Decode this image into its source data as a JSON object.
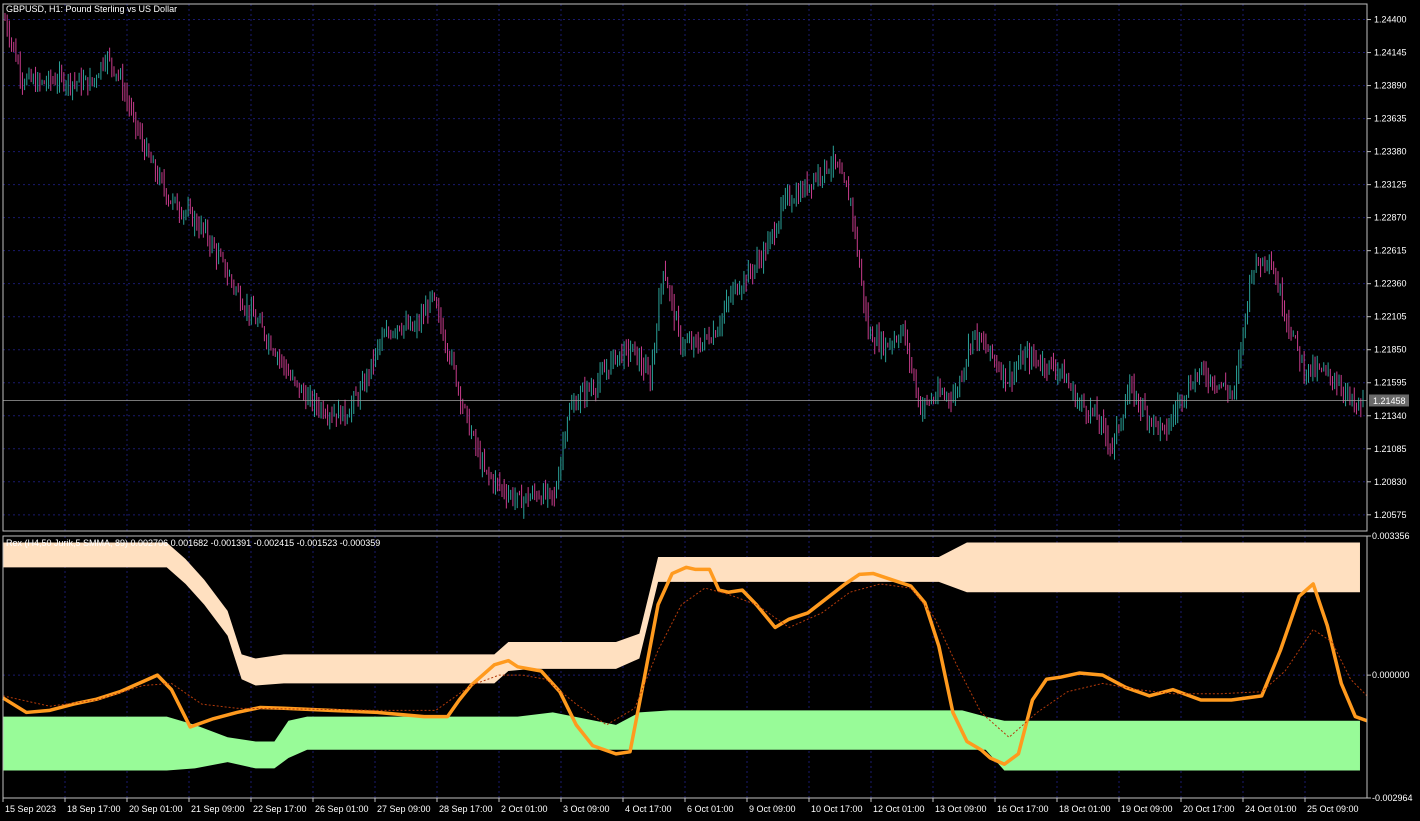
{
  "main_title": "GBPUSD, H1:  Pound Sterling vs US Dollar",
  "indicator_title": "Rex (H4,50 Jurik,5 SMMA, 89) 0.002706 0.001682 -0.001391 -0.002415 -0.001523 -0.000359",
  "current_price_label": "1.21458",
  "colors": {
    "background": "#000000",
    "frame": "#c0c0c0",
    "grid": "#1a1a6e",
    "bull_candle": "#2aa198",
    "bear_candle": "#c83c8c",
    "upper_band": "#ffe0c0",
    "lower_band": "#98fb98",
    "rex_line": "#ff9a1e",
    "signal_line": "#b43a0a",
    "price_line": "#a0a0a0"
  },
  "chart_data": [
    {
      "type": "candlestick",
      "symbol": "GBPUSD",
      "timeframe": "H1",
      "ylim": [
        1.2045,
        1.2452
      ],
      "y_ticks": [
        "1.24400",
        "1.24145",
        "1.23890",
        "1.23635",
        "1.23380",
        "1.23125",
        "1.22870",
        "1.22615",
        "1.22360",
        "1.22105",
        "1.21850",
        "1.21595",
        "1.21340",
        "1.21085",
        "1.20830",
        "1.20575"
      ],
      "current_price": 1.21458,
      "close_path": [
        [
          0,
          1.244
        ],
        [
          8,
          1.2395
        ],
        [
          16,
          1.239
        ],
        [
          24,
          1.2394
        ],
        [
          32,
          1.2392
        ],
        [
          40,
          1.2391
        ],
        [
          46,
          1.2412
        ],
        [
          52,
          1.2398
        ],
        [
          60,
          1.2357
        ],
        [
          68,
          1.2325
        ],
        [
          76,
          1.23
        ],
        [
          84,
          1.229
        ],
        [
          92,
          1.2275
        ],
        [
          100,
          1.225
        ],
        [
          108,
          1.2225
        ],
        [
          116,
          1.2205
        ],
        [
          124,
          1.2185
        ],
        [
          132,
          1.216
        ],
        [
          140,
          1.2145
        ],
        [
          148,
          1.2138
        ],
        [
          156,
          1.2135
        ],
        [
          164,
          1.2155
        ],
        [
          172,
          1.219
        ],
        [
          180,
          1.2205
        ],
        [
          188,
          1.22
        ],
        [
          196,
          1.2225
        ],
        [
          204,
          1.2182
        ],
        [
          212,
          1.213
        ],
        [
          220,
          1.209
        ],
        [
          228,
          1.2078
        ],
        [
          236,
          1.2068
        ],
        [
          244,
          1.2074
        ],
        [
          252,
          1.207
        ],
        [
          258,
          1.2135
        ],
        [
          264,
          1.215
        ],
        [
          272,
          1.216
        ],
        [
          280,
          1.218
        ],
        [
          288,
          1.2185
        ],
        [
          296,
          1.2162
        ],
        [
          302,
          1.225
        ],
        [
          310,
          1.219
        ],
        [
          318,
          1.2188
        ],
        [
          326,
          1.22
        ],
        [
          334,
          1.223
        ],
        [
          342,
          1.2245
        ],
        [
          350,
          1.2265
        ],
        [
          358,
          1.23
        ],
        [
          366,
          1.2308
        ],
        [
          372,
          1.232
        ],
        [
          380,
          1.233
        ],
        [
          388,
          1.23
        ],
        [
          396,
          1.2198
        ],
        [
          404,
          1.2188
        ],
        [
          412,
          1.22
        ],
        [
          420,
          1.214
        ],
        [
          428,
          1.215
        ],
        [
          436,
          1.215
        ],
        [
          444,
          1.2198
        ],
        [
          452,
          1.2182
        ],
        [
          460,
          1.2162
        ],
        [
          468,
          1.218
        ],
        [
          476,
          1.2175
        ],
        [
          484,
          1.217
        ],
        [
          492,
          1.2145
        ],
        [
          500,
          1.2135
        ],
        [
          508,
          1.211
        ],
        [
          516,
          1.2155
        ],
        [
          524,
          1.2135
        ],
        [
          532,
          1.212
        ],
        [
          540,
          1.215
        ],
        [
          548,
          1.2168
        ],
        [
          556,
          1.216
        ],
        [
          564,
          1.215
        ],
        [
          572,
          1.2248
        ],
        [
          580,
          1.2258
        ],
        [
          588,
          1.221
        ],
        [
          596,
          1.217
        ],
        [
          604,
          1.2168
        ],
        [
          612,
          1.216
        ],
        [
          620,
          1.2138
        ],
        [
          623,
          1.2145
        ]
      ]
    },
    {
      "type": "line",
      "name": "Rex",
      "ylim": [
        -0.002964,
        0.003356
      ],
      "y_ticks": [
        "0.003356",
        "0.000000",
        "-0.002964"
      ],
      "series": [
        {
          "name": "rex",
          "points": [
            [
              0,
              -0.00055
            ],
            [
              10,
              -0.0009
            ],
            [
              20,
              -0.00085
            ],
            [
              30,
              -0.0007
            ],
            [
              40,
              -0.00058
            ],
            [
              50,
              -0.0004
            ],
            [
              60,
              -0.00015
            ],
            [
              66,
              0.0
            ],
            [
              72,
              -0.00035
            ],
            [
              80,
              -0.00125
            ],
            [
              90,
              -0.00105
            ],
            [
              100,
              -0.0009
            ],
            [
              110,
              -0.00078
            ],
            [
              120,
              -0.0008
            ],
            [
              140,
              -0.00085
            ],
            [
              160,
              -0.0009
            ],
            [
              180,
              -0.001
            ],
            [
              190,
              -0.001
            ],
            [
              195,
              -0.0006
            ],
            [
              200,
              -0.00025
            ],
            [
              210,
              0.00025
            ],
            [
              216,
              0.00035
            ],
            [
              220,
              0.0002
            ],
            [
              230,
              0.0001
            ],
            [
              238,
              -0.0004
            ],
            [
              245,
              -0.0012
            ],
            [
              252,
              -0.0017
            ],
            [
              262,
              -0.0019
            ],
            [
              268,
              -0.00185
            ],
            [
              274,
              -0.0001
            ],
            [
              280,
              0.0017
            ],
            [
              286,
              0.00245
            ],
            [
              292,
              0.0026
            ],
            [
              296,
              0.00255
            ],
            [
              302,
              0.00255
            ],
            [
              306,
              0.00205
            ],
            [
              310,
              0.002
            ],
            [
              316,
              0.00205
            ],
            [
              322,
              0.0017
            ],
            [
              330,
              0.00115
            ],
            [
              336,
              0.00135
            ],
            [
              344,
              0.0015
            ],
            [
              352,
              0.00185
            ],
            [
              360,
              0.0022
            ],
            [
              366,
              0.00243
            ],
            [
              372,
              0.00245
            ],
            [
              380,
              0.0023
            ],
            [
              388,
              0.00215
            ],
            [
              394,
              0.00175
            ],
            [
              400,
              0.0007
            ],
            [
              406,
              -0.0009
            ],
            [
              412,
              -0.0016
            ],
            [
              418,
              -0.0018
            ],
            [
              422,
              -0.002
            ],
            [
              428,
              -0.00215
            ],
            [
              434,
              -0.0019
            ],
            [
              440,
              -0.0006
            ],
            [
              446,
              -0.0001
            ],
            [
              452,
              -5e-05
            ],
            [
              460,
              5e-05
            ],
            [
              470,
              0.0
            ],
            [
              480,
              -0.0003
            ],
            [
              490,
              -0.0005
            ],
            [
              500,
              -0.00035
            ],
            [
              512,
              -0.0006
            ],
            [
              525,
              -0.0006
            ],
            [
              538,
              -0.0005
            ],
            [
              546,
              0.0006
            ],
            [
              554,
              0.0019
            ],
            [
              560,
              0.0022
            ],
            [
              566,
              0.0012
            ],
            [
              572,
              -0.0002
            ],
            [
              578,
              -0.001
            ],
            [
              583,
              -0.0011
            ]
          ]
        },
        {
          "name": "signal",
          "points": [
            [
              0,
              -0.0005
            ],
            [
              20,
              -0.00075
            ],
            [
              40,
              -0.0006
            ],
            [
              60,
              -0.00025
            ],
            [
              72,
              -0.0002
            ],
            [
              85,
              -0.0007
            ],
            [
              100,
              -0.0008
            ],
            [
              130,
              -0.00082
            ],
            [
              160,
              -0.00085
            ],
            [
              185,
              -0.00085
            ],
            [
              200,
              -0.00025
            ],
            [
              212,
              0.0
            ],
            [
              222,
              0.0
            ],
            [
              232,
              -0.0001
            ],
            [
              245,
              -0.0007
            ],
            [
              258,
              -0.0012
            ],
            [
              270,
              -0.0008
            ],
            [
              280,
              0.0006
            ],
            [
              290,
              0.0017
            ],
            [
              300,
              0.0021
            ],
            [
              310,
              0.00195
            ],
            [
              322,
              0.0017
            ],
            [
              336,
              0.00115
            ],
            [
              350,
              0.0015
            ],
            [
              362,
              0.002
            ],
            [
              375,
              0.0022
            ],
            [
              388,
              0.0021
            ],
            [
              398,
              0.0014
            ],
            [
              408,
              0.0002
            ],
            [
              418,
              -0.0009
            ],
            [
              430,
              -0.0015
            ],
            [
              442,
              -0.0009
            ],
            [
              455,
              -0.0004
            ],
            [
              470,
              -0.0002
            ],
            [
              485,
              -0.00035
            ],
            [
              500,
              -0.00045
            ],
            [
              520,
              -0.00045
            ],
            [
              538,
              -0.0004
            ],
            [
              548,
              0.0001
            ],
            [
              560,
              0.0011
            ],
            [
              568,
              0.0008
            ],
            [
              576,
              -0.0001
            ],
            [
              583,
              -0.0005
            ]
          ]
        },
        {
          "name": "upper_band",
          "points": [
            [
              0,
              0.0026,
              0.0032
            ],
            [
              70,
              0.0026,
              0.0032
            ],
            [
              78,
              0.0022,
              0.0028
            ],
            [
              86,
              0.0017,
              0.0023
            ],
            [
              96,
              0.00095,
              0.00155
            ],
            [
              102,
              -0.0001,
              0.0005
            ],
            [
              108,
              -0.00025,
              0.0004
            ],
            [
              120,
              -0.0002,
              0.0005
            ],
            [
              200,
              -0.0002,
              0.0005
            ],
            [
              210,
              -0.0002,
              0.0005
            ],
            [
              216,
              0.0001,
              0.0008
            ],
            [
              226,
              0.00015,
              0.0008
            ],
            [
              262,
              0.00015,
              0.0008
            ],
            [
              272,
              0.0004,
              0.001
            ],
            [
              280,
              0.00225,
              0.00285
            ],
            [
              400,
              0.00225,
              0.00285
            ],
            [
              412,
              0.002,
              0.0032
            ],
            [
              580,
              0.002,
              0.0032
            ]
          ]
        },
        {
          "name": "lower_band",
          "points": [
            [
              0,
              -0.0023,
              -0.001
            ],
            [
              60,
              -0.0023,
              -0.001
            ],
            [
              70,
              -0.0023,
              -0.001
            ],
            [
              82,
              -0.00225,
              -0.0012
            ],
            [
              96,
              -0.0021,
              -0.0015
            ],
            [
              108,
              -0.00225,
              -0.0016
            ],
            [
              116,
              -0.00225,
              -0.0016
            ],
            [
              122,
              -0.002,
              -0.0011
            ],
            [
              130,
              -0.0018,
              -0.001
            ],
            [
              200,
              -0.0018,
              -0.001
            ],
            [
              220,
              -0.0018,
              -0.001
            ],
            [
              235,
              -0.0018,
              -0.0009
            ],
            [
              262,
              -0.0018,
              -0.0012
            ],
            [
              272,
              -0.0018,
              -0.0009
            ],
            [
              285,
              -0.0018,
              -0.00085
            ],
            [
              410,
              -0.0018,
              -0.00085
            ],
            [
              420,
              -0.0018,
              -0.001
            ],
            [
              428,
              -0.0023,
              -0.0011
            ],
            [
              436,
              -0.0023,
              -0.0011
            ],
            [
              580,
              -0.0023,
              -0.0011
            ]
          ]
        }
      ]
    }
  ],
  "x_axis_labels": [
    "15 Sep 2023",
    "18 Sep 17:00",
    "20 Sep 01:00",
    "21 Sep 09:00",
    "22 Sep 17:00",
    "26 Sep 01:00",
    "27 Sep 09:00",
    "28 Sep 17:00",
    "2 Oct 01:00",
    "3 Oct 09:00",
    "4 Oct 17:00",
    "6 Oct 01:00",
    "9 Oct 09:00",
    "10 Oct 17:00",
    "12 Oct 01:00",
    "13 Oct 09:00",
    "16 Oct 17:00",
    "18 Oct 01:00",
    "19 Oct 09:00",
    "20 Oct 17:00",
    "24 Oct 01:00",
    "25 Oct 09:00"
  ]
}
